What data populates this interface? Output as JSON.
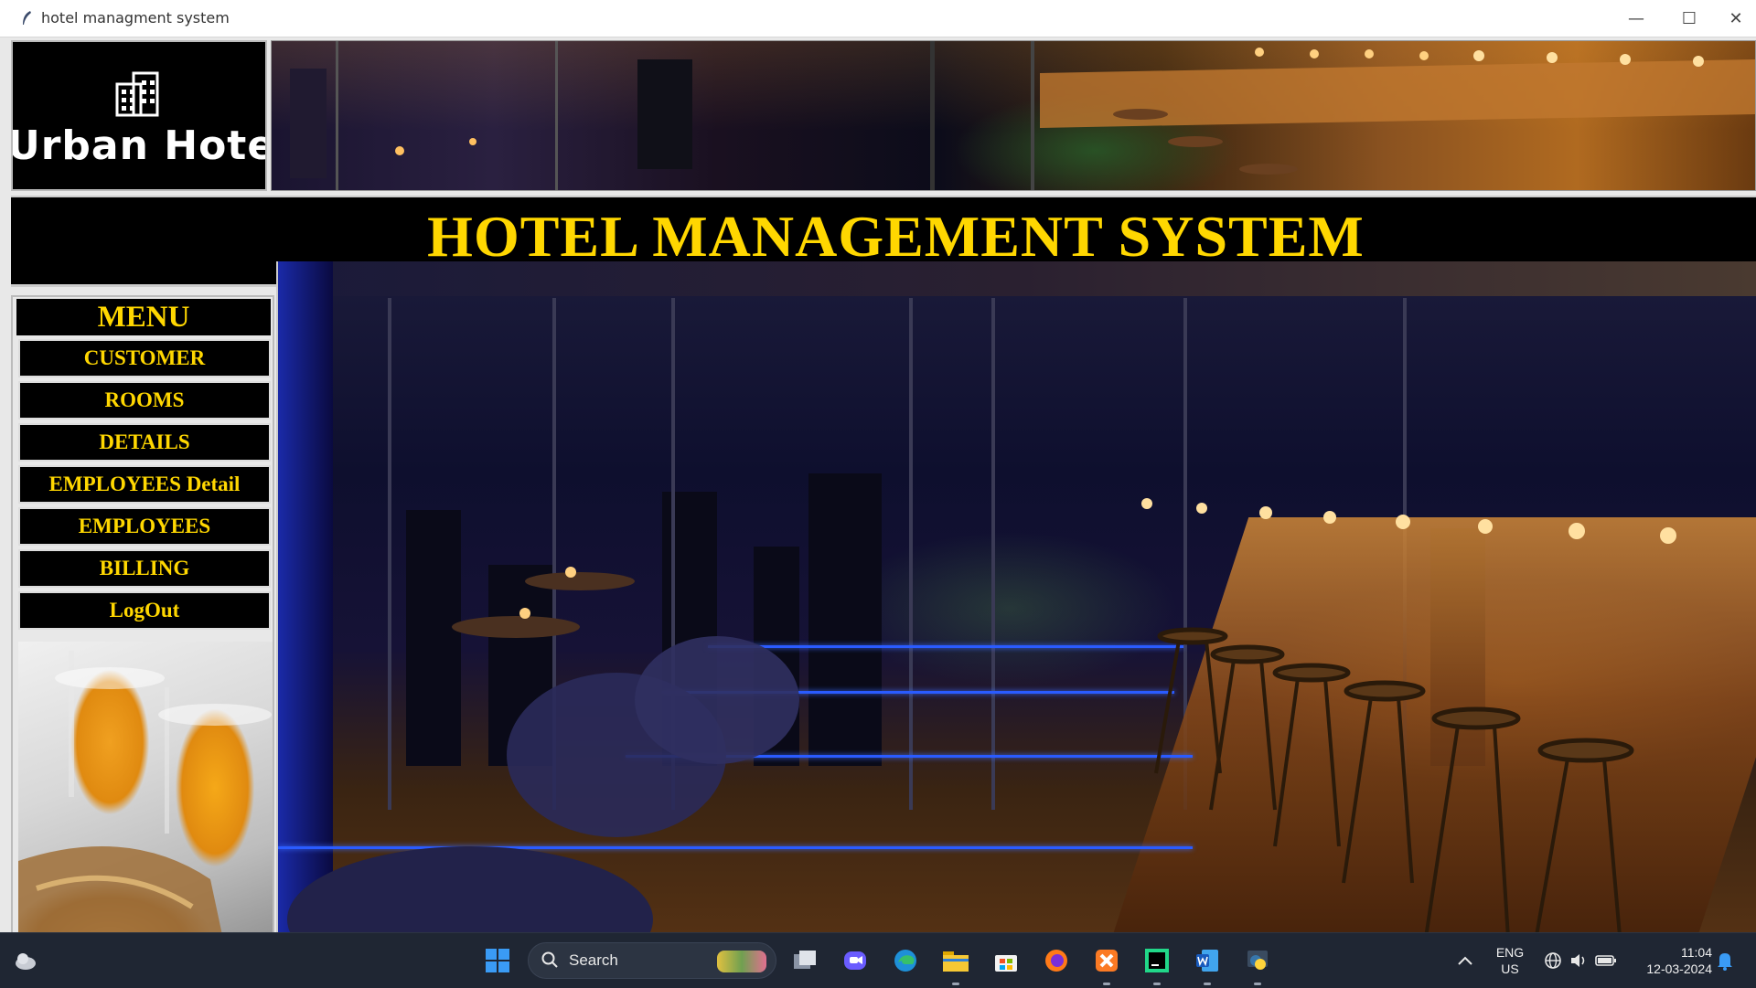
{
  "window": {
    "title": "hotel managment system",
    "controls": {
      "minimize": "—",
      "maximize": "☐",
      "close": "✕"
    }
  },
  "logo": {
    "text": "Urban Hotel",
    "icon": "building-icon"
  },
  "header": {
    "title": "HOTEL MANAGEMENT SYSTEM"
  },
  "menu": {
    "title": "MENU",
    "items": [
      {
        "label": "CUSTOMER"
      },
      {
        "label": "ROOMS"
      },
      {
        "label": "DETAILS"
      },
      {
        "label": "EMPLOYEES Detail"
      },
      {
        "label": "EMPLOYEES"
      },
      {
        "label": "BILLING"
      },
      {
        "label": "LogOut"
      }
    ]
  },
  "taskbar": {
    "search_label": "Search",
    "pinned": [
      "windows-start-icon",
      "task-view-icon",
      "chat-icon",
      "edge-icon",
      "file-explorer-icon",
      "microsoft-store-icon",
      "firefox-icon",
      "xampp-icon",
      "pycharm-icon",
      "word-icon",
      "python-icon"
    ],
    "language": {
      "line1": "ENG",
      "line2": "US"
    },
    "clock": {
      "time": "11:04",
      "date": "12-03-2024"
    }
  },
  "colors": {
    "accent_text": "#ffd700",
    "panel_bg": "#000000",
    "taskbar_bg": "#1f2633"
  }
}
